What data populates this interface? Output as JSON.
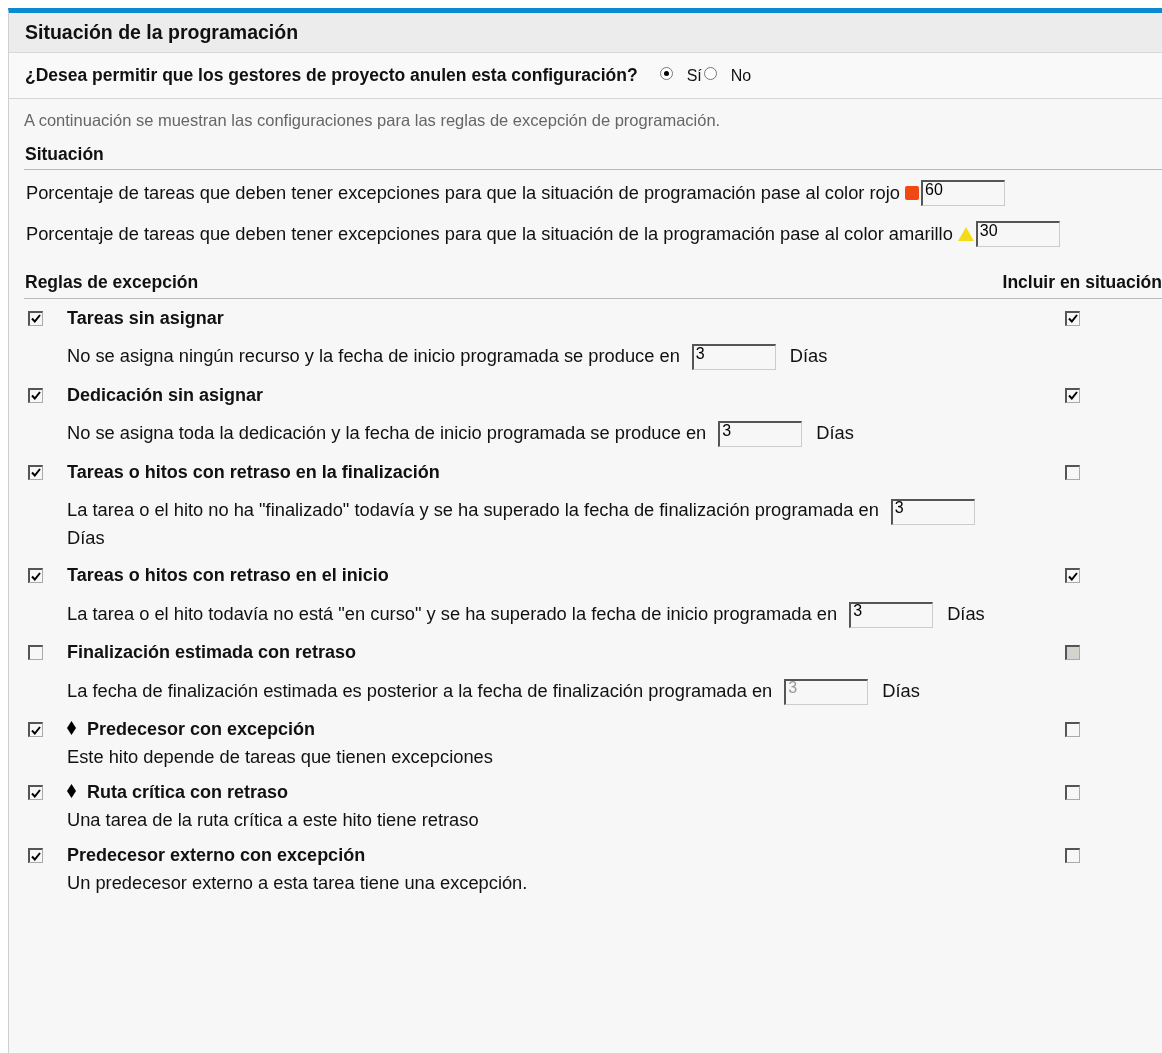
{
  "panel": {
    "title": "Situación de la programación"
  },
  "override": {
    "question": "¿Desea permitir que los gestores de proyecto anulen esta configuración?",
    "options": [
      {
        "label": "Sí",
        "selected": true
      },
      {
        "label": "No",
        "selected": false
      }
    ]
  },
  "intro": "A continuación se muestran las configuraciones para las reglas de excepción de programación.",
  "status": {
    "heading": "Situación",
    "thresholds": [
      {
        "label": "Porcentaje de tareas que deben tener excepciones para que la situación de programación pase al color rojo",
        "kind": "square",
        "color": "#f04a14",
        "value": "60"
      },
      {
        "label": "Porcentaje de tareas que deben tener excepciones para que la situación de la programación pase al color amarillo",
        "kind": "triangle",
        "color": "#f2dc1a",
        "value": "30"
      }
    ]
  },
  "rules": {
    "heading": "Reglas de excepción",
    "include_heading": "Incluir en situación",
    "items": [
      {
        "checked": true,
        "title": "Tareas sin asignar",
        "milestone": false,
        "description": "No se asigna ningún recurso y la fecha de inicio programada se produce en",
        "value": "3",
        "unit": "Días",
        "disabled": false,
        "include_checked": true
      },
      {
        "checked": true,
        "title": "Dedicación sin asignar",
        "milestone": false,
        "description": "No se asigna toda la dedicación y la fecha de inicio programada se produce en",
        "value": "3",
        "unit": "Días",
        "disabled": false,
        "include_checked": true
      },
      {
        "checked": true,
        "title": "Tareas o hitos con retraso en la finalización",
        "milestone": false,
        "description": "La tarea o el hito no ha \"finalizado\" todavía y se ha superado la fecha de finalización programada en",
        "value": "3",
        "unit": "Días",
        "disabled": false,
        "include_checked": false
      },
      {
        "checked": true,
        "title": "Tareas o hitos con retraso en el inicio",
        "milestone": false,
        "description": "La tarea o el hito todavía no está \"en curso\" y se ha superado la fecha de inicio programada en",
        "value": "3",
        "unit": "Días",
        "disabled": false,
        "include_checked": true
      },
      {
        "checked": false,
        "title": "Finalización estimada con retraso",
        "milestone": false,
        "description": "La fecha de finalización estimada es posterior a la fecha de finalización programada en",
        "value": "3",
        "unit": "Días",
        "disabled": true,
        "include_checked": false
      },
      {
        "checked": true,
        "title": "Predecesor con excepción",
        "milestone": true,
        "description": "Este hito depende de tareas que tienen excepciones",
        "disabled": false,
        "include_checked": false
      },
      {
        "checked": true,
        "title": "Ruta crítica con retraso",
        "milestone": true,
        "description": "Una tarea de la ruta crítica a este hito tiene retraso",
        "disabled": false,
        "include_checked": false
      },
      {
        "checked": true,
        "title": "Predecesor externo con excepción",
        "milestone": false,
        "description": "Un predecesor externo a esta tarea tiene una excepción.",
        "disabled": false,
        "include_checked": false
      }
    ]
  }
}
